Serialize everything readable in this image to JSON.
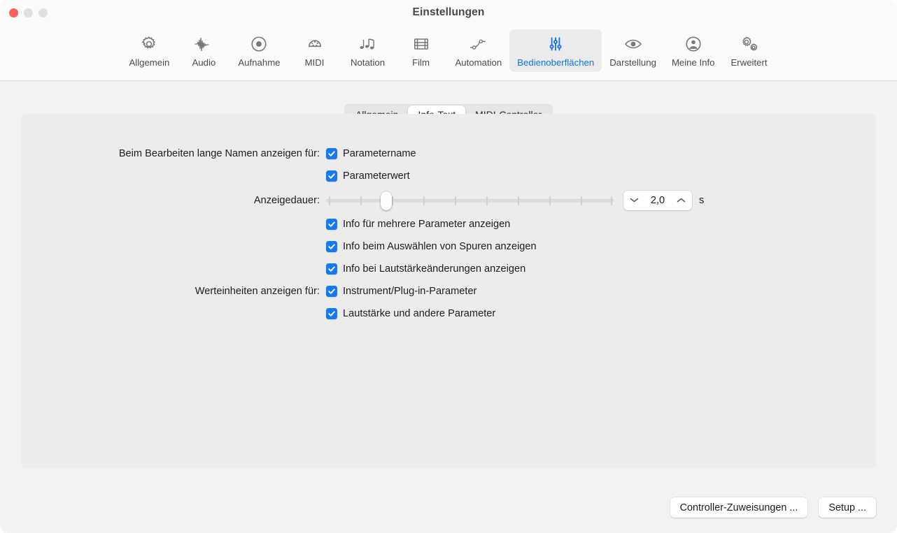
{
  "window": {
    "title": "Einstellungen",
    "traffic_lights": [
      "close",
      "minimize",
      "maximize"
    ]
  },
  "toolbar": {
    "items": [
      {
        "label": "Allgemein",
        "icon": "gear-icon",
        "selected": false
      },
      {
        "label": "Audio",
        "icon": "waveform-icon",
        "selected": false
      },
      {
        "label": "Aufnahme",
        "icon": "record-circle-icon",
        "selected": false
      },
      {
        "label": "MIDI",
        "icon": "midi-connector-icon",
        "selected": false
      },
      {
        "label": "Notation",
        "icon": "music-notes-icon",
        "selected": false
      },
      {
        "label": "Film",
        "icon": "film-strip-icon",
        "selected": false
      },
      {
        "label": "Automation",
        "icon": "automation-node-icon",
        "selected": false
      },
      {
        "label": "Bedienoberflächen",
        "icon": "sliders-icon",
        "selected": true
      },
      {
        "label": "Darstellung",
        "icon": "eye-icon",
        "selected": false
      },
      {
        "label": "Meine Info",
        "icon": "person-circle-icon",
        "selected": false
      },
      {
        "label": "Erweitert",
        "icon": "double-gear-icon",
        "selected": false
      }
    ],
    "accent_color": "#1173ee"
  },
  "tabs": {
    "items": [
      {
        "label": "Allgemein",
        "active": false
      },
      {
        "label": "Info-Text",
        "active": true
      },
      {
        "label": "MIDI-Controller",
        "active": false
      }
    ]
  },
  "form": {
    "long_names_label": "Beim Bearbeiten lange Namen anzeigen für:",
    "long_names_options": [
      {
        "label": "Parametername",
        "checked": true
      },
      {
        "label": "Parameterwert",
        "checked": true
      }
    ],
    "duration_label": "Anzeigedauer:",
    "duration_value": "2,0",
    "duration_unit": "s",
    "duration_slider": {
      "min": 0.5,
      "max": 10.0,
      "value": 2.0,
      "tick_count": 10
    },
    "info_options": [
      {
        "label": "Info für mehrere Parameter anzeigen",
        "checked": true
      },
      {
        "label": "Info beim Auswählen von Spuren anzeigen",
        "checked": true
      },
      {
        "label": "Info bei Lautstärkeänderungen anzeigen",
        "checked": true
      }
    ],
    "units_label": "Werteinheiten anzeigen für:",
    "units_options": [
      {
        "label": "Instrument/Plug-in-Parameter",
        "checked": true
      },
      {
        "label": "Lautstärke und andere Parameter",
        "checked": true
      }
    ],
    "checkbox_color": "#1479f2"
  },
  "footer": {
    "controller_assignments_button": "Controller-Zuweisungen ...",
    "setup_button": "Setup ..."
  }
}
